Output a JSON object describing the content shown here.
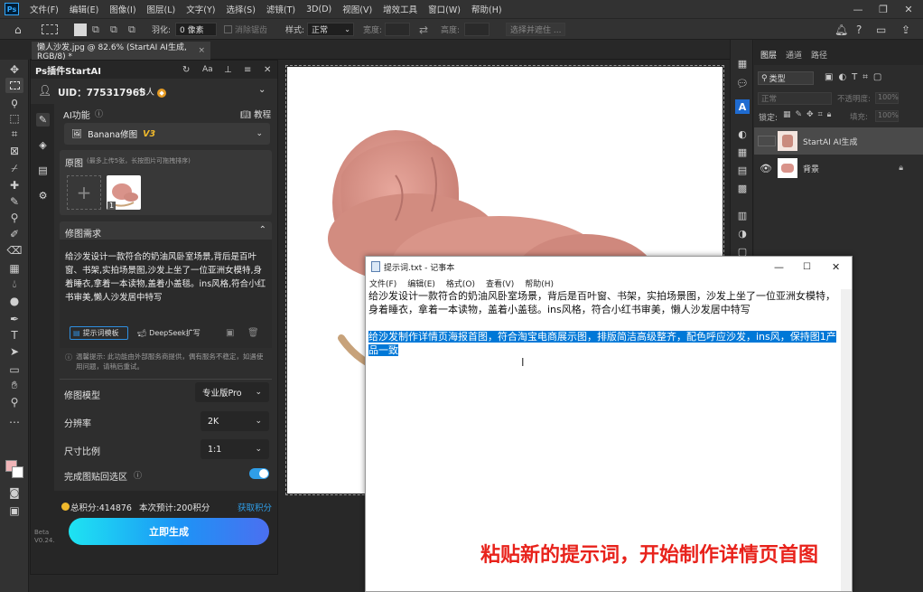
{
  "app": {
    "logo": "Ps",
    "menu": [
      "文件(F)",
      "编辑(E)",
      "图像(I)",
      "图层(L)",
      "文字(Y)",
      "选择(S)",
      "滤镜(T)",
      "3D(D)",
      "视图(V)",
      "增效工具",
      "窗口(W)",
      "帮助(H)"
    ]
  },
  "options_bar": {
    "feather_label": "羽化:",
    "feather_value": "0 像素",
    "antialias_label": "消除锯齿",
    "style_label": "样式:",
    "style_value": "正常",
    "width_label": "宽度:",
    "height_label": "高度:",
    "select_subject": "选择并遮住 ..."
  },
  "document_tab": {
    "title": "懒人沙发.jpg @ 82.6% (StartAI AI生成, RGB/8) *",
    "close": "×"
  },
  "plugin": {
    "title": "Ps插件StartAI",
    "uid": "UID：775317965",
    "account_type": "个人",
    "ai_function_label": "AI功能",
    "tutorial_label": "教程",
    "model_selected": "Banana修图",
    "model_version": "V3",
    "source_image_label": "原图",
    "source_image_hint": "(最多上传5张，长按图片可拖拽排序)",
    "thumb_index": "1",
    "requirement_label": "修图需求",
    "requirement_text": "给沙发设计一款符合的奶油风卧室场景,背后是百叶窗、书架,实拍场景图,沙发上坐了一位亚洲女模特,身着睡衣,拿着一本读物,盖着小盖毯。ins风格,符合小红书审美,懒人沙发居中特写",
    "template_button": "提示词模板",
    "deepseek_button": "DeepSeek扩写",
    "notice": "温馨提示: 此功能由外部服务商提供，偶有服务不稳定，如遇使用问题，请稍后重试。",
    "model_label": "修图模型",
    "model_value": "专业版Pro",
    "resolution_label": "分辨率",
    "resolution_value": "2K",
    "ratio_label": "尺寸比例",
    "ratio_value": "1:1",
    "paste_back_label": "完成图贴回选区",
    "paste_back_on": true,
    "points_total": "总积分:414876",
    "points_estimate": "本次预计:200积分",
    "get_points": "获取积分",
    "generate_button": "立即生成",
    "version": "Beta\nV0.24.2"
  },
  "layers_panel": {
    "tabs": [
      "图层",
      "通道",
      "路径"
    ],
    "filter_kind": "类型",
    "blend_mode": "正常",
    "opacity_label": "不透明度:",
    "opacity_value": "100%",
    "lock_label": "锁定:",
    "fill_label": "填充:",
    "fill_value": "100%",
    "layers": [
      {
        "name": "StartAI AI生成",
        "visible": false,
        "selected": true
      },
      {
        "name": "背景",
        "visible": true,
        "locked": true
      }
    ]
  },
  "notepad": {
    "title": "提示词.txt - 记事本",
    "menu": [
      "文件(F)",
      "编辑(E)",
      "格式(O)",
      "查看(V)",
      "帮助(H)"
    ],
    "line1": "给沙发设计一款符合的奶油风卧室场景，背后是百叶窗、书架，实拍场景图，沙发上坐了一位亚洲女模特，身着睡衣，拿着一本读物，盖着小盖毯。ins风格，符合小红书审美，懒人沙发居中特写",
    "selected_text": "给沙发制作详情页海报首图，符合淘宝电商展示图，排版简洁高级整齐，配色呼应沙发，ins风，保持图1产品一致"
  },
  "caption": "粘贴新的提示词，开始制作详情页首图",
  "colors": {
    "accent": "#1c94f6",
    "highlight": "#0078d7",
    "caption": "#e8221b",
    "sofa": "#d9938a"
  },
  "icons": {
    "home": "home-icon",
    "pin": "pin-icon",
    "refresh": "refresh-icon",
    "close": "close-icon"
  }
}
